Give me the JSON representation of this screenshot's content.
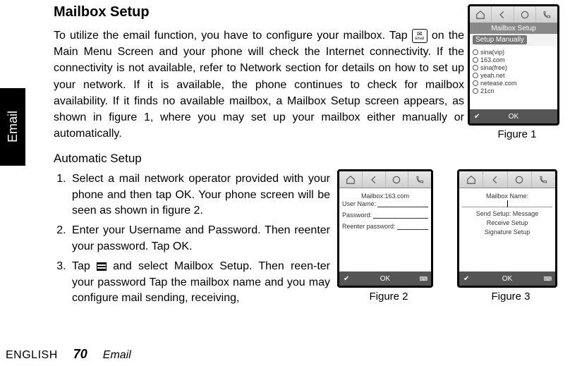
{
  "side_tab": "Email",
  "heading": "Mailbox Setup",
  "intro_parts": {
    "p1": "To utilize the email function, you have to configure your mailbox. Tap ",
    "p2": " on the Main Menu Screen and your phone will check the Internet connectivity. If the connectivity is not available, refer to Network section for details on how to set up your network. If it is available, the phone continues to check for mailbox availability. If it finds no available mailbox, a Mailbox Setup screen appears, as shown in figure 1, where you may set up your mailbox either manually or automatically."
  },
  "email_icon_label": "Email",
  "subheading": "Automatic Setup",
  "steps": [
    "Select a mail network operator provided with your phone and then tap OK. Your phone screen will be seen as shown in figure 2.",
    "Enter your Username and Password. Then reenter your password. Tap OK.",
    "Tap MENU_ICON and select Mailbox Setup. Then reen-ter your password Tap the mailbox name and you may configure mail sending, receiving,"
  ],
  "footer": {
    "lang": "ENGLISH",
    "page": "70",
    "section": "Email"
  },
  "figures": {
    "f1": {
      "caption": "Figure 1",
      "title": "Mailbox Setup",
      "button": "Setup Manually",
      "list": [
        "sina(vip)",
        "163.com",
        "sina(free)",
        "yeah.net",
        "netease.com",
        "21cn"
      ],
      "ok": "OK"
    },
    "f2": {
      "caption": "Figure 2",
      "mailbox_label": "Mailbox:163.com",
      "username_label": "User Name:",
      "password_label": "Password:",
      "reenter_label": "Reenter password:",
      "ok": "OK"
    },
    "f3": {
      "caption": "Figure 3",
      "name_label": "Mailbox Name:",
      "send_label": "Send Setup: Message",
      "receive_label": "Receive Setup",
      "sig_label": "Signature Setup",
      "ok": "OK"
    }
  }
}
